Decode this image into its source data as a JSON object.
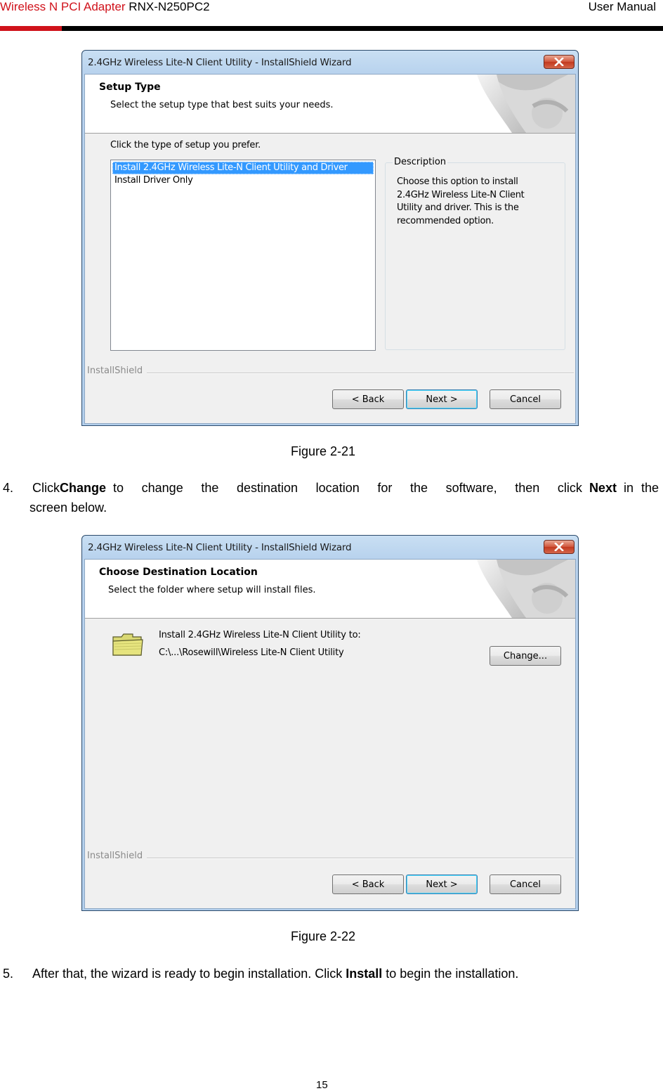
{
  "header": {
    "brand": "Wireless N PCI Adapter",
    "model": "RNX-N250PC2",
    "right": "User Manual",
    "accent_color": "#d0121b"
  },
  "figure1": {
    "window_title": "2.4GHz Wireless Lite-N Client Utility - InstallShield Wizard",
    "banner_title": "Setup Type",
    "banner_subtitle": "Select the setup type that best suits your needs.",
    "prompt": "Click the type of setup you prefer.",
    "list_items": [
      {
        "label": "Install 2.4GHz Wireless Lite-N Client Utility and Driver",
        "selected": true
      },
      {
        "label": "Install Driver Only",
        "selected": false
      }
    ],
    "description_legend": "Description",
    "description_lines": [
      "Choose this option to install",
      "2.4GHz Wireless Lite-N Client",
      "Utility and driver. This is the",
      "recommended option."
    ],
    "installshield_label": "InstallShield",
    "buttons": {
      "back": "< Back",
      "next": "Next >",
      "cancel": "Cancel"
    },
    "caption": "Figure 2-21"
  },
  "step4": {
    "number": "4.",
    "click": "Click",
    "change": "Change",
    "middle": "to change the destination location for the software, then click",
    "next": "Next",
    "in_the": "in the",
    "line2": "screen below."
  },
  "figure2": {
    "window_title": "2.4GHz Wireless Lite-N Client Utility - InstallShield Wizard",
    "banner_title": "Choose Destination Location",
    "banner_subtitle": "Select the folder where setup will install files.",
    "install_to": "Install 2.4GHz Wireless Lite-N Client Utility to:",
    "path": "C:\\...\\Rosewill\\Wireless Lite-N Client Utility",
    "change_button": "Change...",
    "installshield_label": "InstallShield",
    "buttons": {
      "back": "< Back",
      "next": "Next >",
      "cancel": "Cancel"
    },
    "caption": "Figure 2-22"
  },
  "step5": {
    "number": "5.",
    "before": "After that, the wizard is ready to begin installation. Click",
    "install": "Install",
    "after": "to begin the installation."
  },
  "page_number": "15"
}
